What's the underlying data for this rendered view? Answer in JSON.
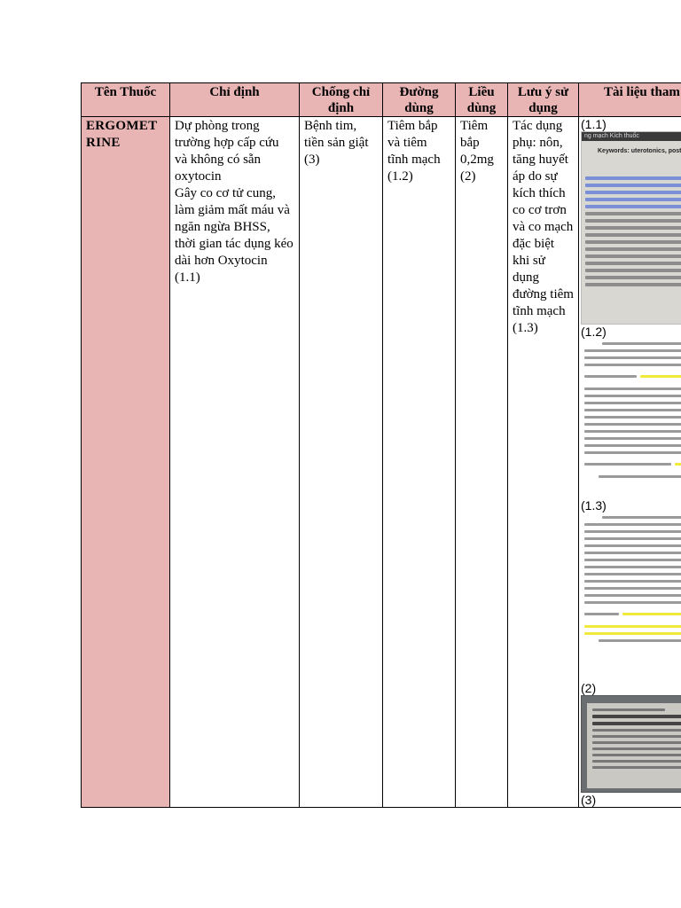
{
  "table": {
    "headers": {
      "drug_name": "Tên Thuốc",
      "indication": "Chỉ định",
      "contraindication": "Chống chỉ định",
      "route": "Đường dùng",
      "dose": "Liều dùng",
      "notes": "Lưu ý sử dụng",
      "references": "Tài liệu tham"
    },
    "row": {
      "drug_name": "ERGOMET\nRINE",
      "indication": "Dự phòng trong trường hợp cấp cứu và không có sẵn oxytocin\nGây co cơ tử cung, làm giảm mất máu và ngăn ngừa BHSS, thời gian tác dụng kéo dài hơn Oxytocin (1.1)",
      "contraindication": "Bệnh tim, tiền sản giật (3)",
      "route": "Tiêm bắp và tiêm tĩnh mạch (1.2)",
      "dose": "Tiêm bắp 0,2mg (2)",
      "notes": "Tác dụng phụ: nôn, tăng huyết áp do sự kích thích co cơ trơn và co mạch đặc biệt khi sử dụng đường tiêm tĩnh mạch (1.3)"
    },
    "references": [
      {
        "label": "(1.1)",
        "thumb_topbar": "ng mạch Kích thuốc",
        "thumb_keywords": "Keywords: uterotonics, postp"
      },
      {
        "label": "(1.2)"
      },
      {
        "label": "(1.3)"
      },
      {
        "label": "(2)"
      },
      {
        "label": "(3)"
      }
    ]
  },
  "colors": {
    "header_bg": "#e8b4b4",
    "highlight_blue": "#7b8fd8",
    "highlight_yellow": "#f2ea3a"
  }
}
